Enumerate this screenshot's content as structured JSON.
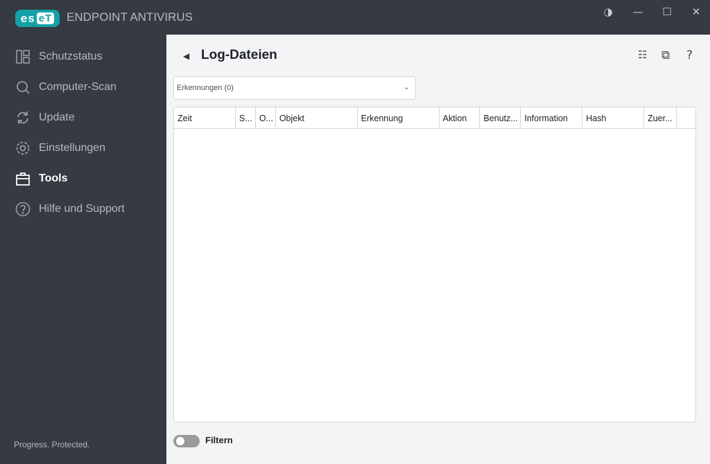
{
  "app": {
    "logo": "eset",
    "product": "ENDPOINT ANTIVIRUS",
    "tagline": "Progress. Protected."
  },
  "window": {
    "theme": "◑",
    "minimize": "—",
    "maximize": "☐",
    "close": "✕"
  },
  "sidebar": {
    "items": [
      {
        "label": "Schutzstatus",
        "icon": "dashboard-icon"
      },
      {
        "label": "Computer-Scan",
        "icon": "search-icon"
      },
      {
        "label": "Update",
        "icon": "refresh-icon"
      },
      {
        "label": "Einstellungen",
        "icon": "gear-icon"
      },
      {
        "label": "Tools",
        "icon": "toolbox-icon",
        "active": true
      },
      {
        "label": "Hilfe und Support",
        "icon": "help-icon"
      }
    ]
  },
  "main": {
    "back": "◀",
    "title": "Log-Dateien",
    "toolbar": {
      "list": "☷",
      "copy": "⧉",
      "help": "?"
    },
    "log_select": {
      "value": "Erkennungen (0)",
      "chevron": "⌄"
    },
    "columns": [
      "Zeit",
      "S...",
      "O...",
      "Objekt",
      "Erkennung",
      "Aktion",
      "Benutz...",
      "Information",
      "Hash",
      "Zuer...",
      ""
    ],
    "filter": {
      "label": "Filtern",
      "enabled": false
    }
  }
}
